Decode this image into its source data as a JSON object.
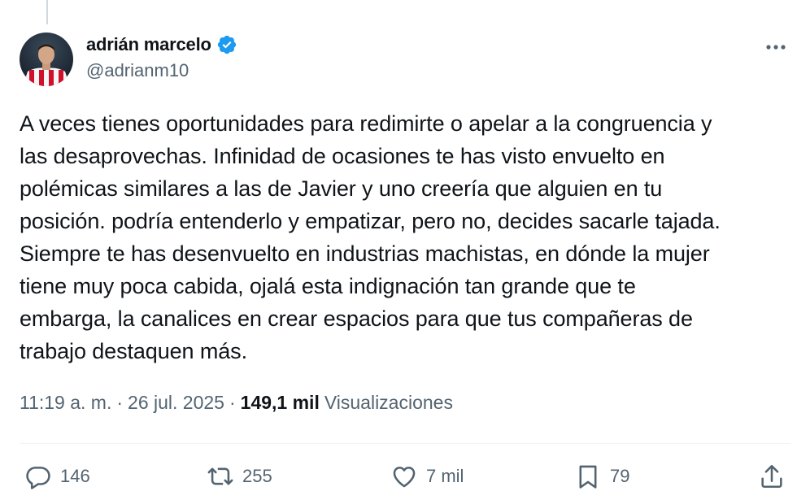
{
  "author": {
    "display_name": "adrián marcelo",
    "handle": "@adrianm10",
    "verified": true
  },
  "tweet": {
    "text": "A veces tienes oportunidades para redimirte o apelar a la congruencia y\nlas desaprovechas. Infinidad de ocasiones te has visto envuelto en\npolémicas similares a las de Javier y uno creería que alguien en tu\nposición. podría entenderlo y empatizar, pero no, decides sacarle tajada.\nSiempre te has desenvuelto en industrias machistas, en dónde la mujer\ntiene muy poca cabida, ojalá esta indignación tan grande que te\nembarga, la canalices en crear espacios para que tus compañeras de\ntrabajo destaquen más.",
    "time": "11:19 a. m.",
    "separator": "·",
    "date": "26 jul. 2025",
    "views_count": "149,1 mil",
    "views_label": "Visualizaciones"
  },
  "actions": {
    "replies": "146",
    "reposts": "255",
    "likes": "7 mil",
    "bookmarks": "79"
  },
  "colors": {
    "verified": "#1d9bf0",
    "secondary_text": "#536471",
    "primary_text": "#0f1419"
  },
  "icons": [
    "verified-badge-icon",
    "more-icon",
    "reply-icon",
    "repost-icon",
    "like-icon",
    "bookmark-icon",
    "share-icon"
  ]
}
